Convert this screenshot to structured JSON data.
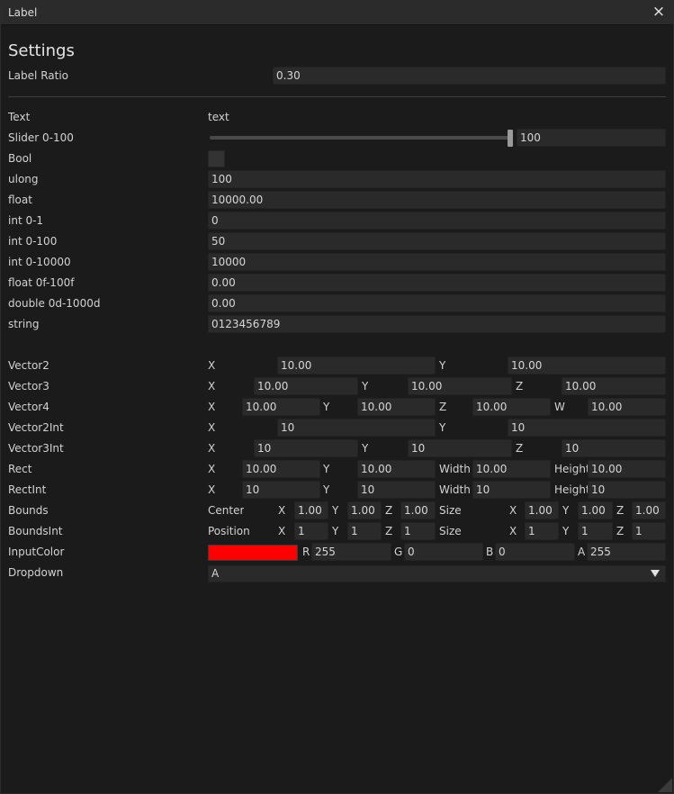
{
  "window": {
    "title": "Label",
    "close_icon": "×"
  },
  "settings": {
    "heading": "Settings",
    "label_ratio_label": "Label Ratio",
    "label_ratio_value": "0.30"
  },
  "rows": {
    "text": {
      "label": "Text",
      "value": "text"
    },
    "slider": {
      "label": "Slider 0-100",
      "value": "100",
      "fraction": 1.0
    },
    "bool": {
      "label": "Bool",
      "checked": false
    },
    "ulong": {
      "label": "ulong",
      "value": "100"
    },
    "float": {
      "label": "float",
      "value": "10000.00"
    },
    "int01": {
      "label": "int 0-1",
      "value": "0"
    },
    "int0100": {
      "label": "int 0-100",
      "value": "50"
    },
    "int010000": {
      "label": "int 0-10000",
      "value": "10000"
    },
    "float0f100f": {
      "label": "float 0f-100f",
      "value": "0.00"
    },
    "double0d1000d": {
      "label": "double 0d-1000d",
      "value": "0.00"
    },
    "string": {
      "label": "string",
      "value": "0123456789"
    }
  },
  "vector2": {
    "label": "Vector2",
    "x_label": "X",
    "x": "10.00",
    "y_label": "Y",
    "y": "10.00"
  },
  "vector3": {
    "label": "Vector3",
    "x_label": "X",
    "x": "10.00",
    "y_label": "Y",
    "y": "10.00",
    "z_label": "Z",
    "z": "10.00"
  },
  "vector4": {
    "label": "Vector4",
    "x_label": "X",
    "x": "10.00",
    "y_label": "Y",
    "y": "10.00",
    "z_label": "Z",
    "z": "10.00",
    "w_label": "W",
    "w": "10.00"
  },
  "vector2int": {
    "label": "Vector2Int",
    "x_label": "X",
    "x": "10",
    "y_label": "Y",
    "y": "10"
  },
  "vector3int": {
    "label": "Vector3Int",
    "x_label": "X",
    "x": "10",
    "y_label": "Y",
    "y": "10",
    "z_label": "Z",
    "z": "10"
  },
  "rect": {
    "label": "Rect",
    "x_label": "X",
    "x": "10.00",
    "y_label": "Y",
    "y": "10.00",
    "w_label": "Width",
    "w": "10.00",
    "h_label": "Height",
    "h": "10.00"
  },
  "rectint": {
    "label": "RectInt",
    "x_label": "X",
    "x": "10",
    "y_label": "Y",
    "y": "10",
    "w_label": "Width",
    "w": "10",
    "h_label": "Height",
    "h": "10"
  },
  "bounds": {
    "label": "Bounds",
    "first_label": "Center",
    "cx_label": "X",
    "cx": "1.00",
    "cy_label": "Y",
    "cy": "1.00",
    "cz_label": "Z",
    "cz": "1.00",
    "second_label": "Size",
    "sx_label": "X",
    "sx": "1.00",
    "sy_label": "Y",
    "sy": "1.00",
    "sz_label": "Z",
    "sz": "1.00"
  },
  "boundsint": {
    "label": "BoundsInt",
    "first_label": "Position",
    "cx_label": "X",
    "cx": "1",
    "cy_label": "Y",
    "cy": "1",
    "cz_label": "Z",
    "cz": "1",
    "second_label": "Size",
    "sx_label": "X",
    "sx": "1",
    "sy_label": "Y",
    "sy": "1",
    "sz_label": "Z",
    "sz": "1"
  },
  "inputcolor": {
    "label": "InputColor",
    "swatch_color": "#ff0000",
    "r_label": "R",
    "r": "255",
    "g_label": "G",
    "g": "0",
    "b_label": "B",
    "b": "0",
    "a_label": "A",
    "a": "255"
  },
  "dropdown": {
    "label": "Dropdown",
    "value": "A"
  }
}
